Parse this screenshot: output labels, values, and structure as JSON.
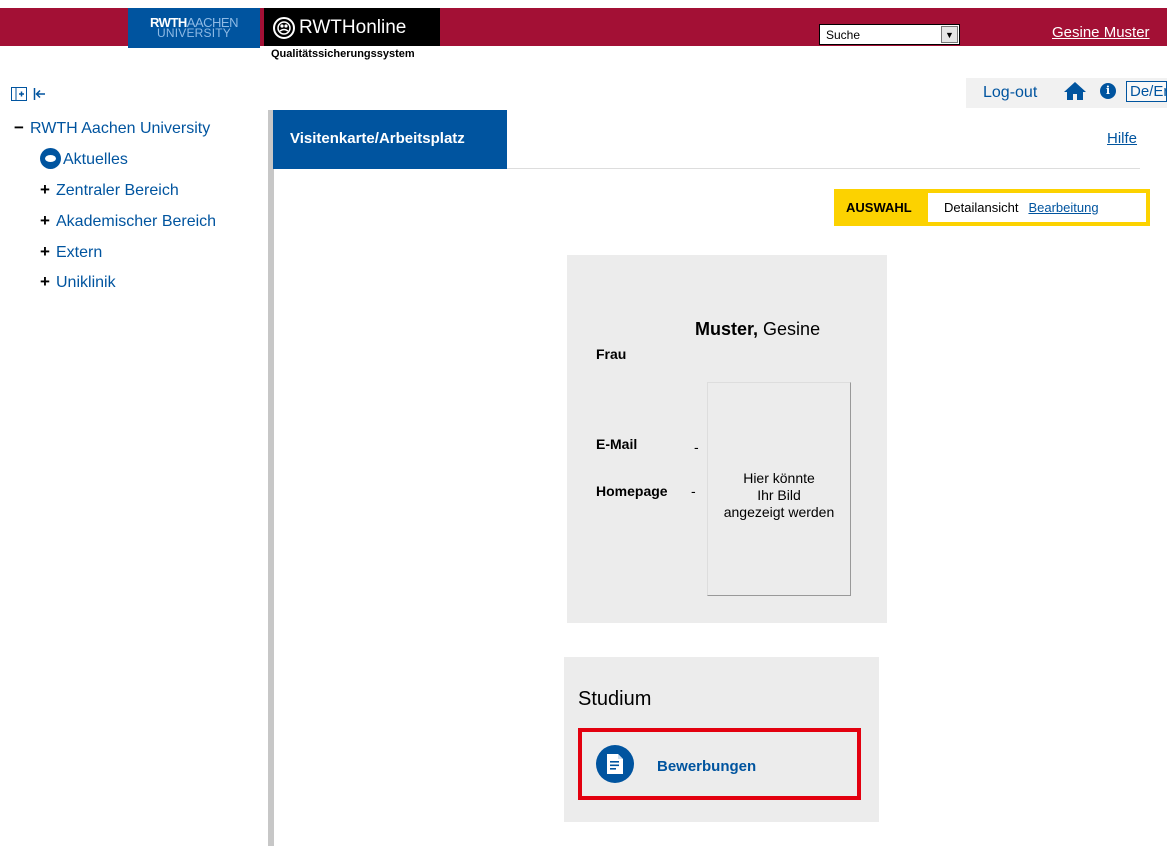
{
  "header": {
    "logo_rwth_bold": "RWTH",
    "logo_aachen": "AACHEN",
    "logo_university": "UNIVERSITY",
    "app_name": "RWTHonline",
    "subtitle": "Qualitätssicherungssystem",
    "search_value": "Suche",
    "user_name": "Gesine Muster",
    "brand_red": "#a31035",
    "brand_blue": "#00549f"
  },
  "utility": {
    "logout": "Log-out",
    "language": "De/En",
    "info_glyph": "i"
  },
  "sidebar": {
    "root": "RWTH Aachen University",
    "items": [
      {
        "label": "Aktuelles",
        "icon": "news-icon"
      },
      {
        "label": "Zentraler Bereich",
        "sym": "+"
      },
      {
        "label": "Akademischer Bereich",
        "sym": "+"
      },
      {
        "label": "Extern",
        "sym": "+"
      },
      {
        "label": "Uniklinik",
        "sym": "+"
      }
    ],
    "root_sym": "−"
  },
  "main": {
    "tab": "Visitenkarte/Arbeitsplatz",
    "help": "Hilfe",
    "auswahl": {
      "label": "AUSWAHL",
      "detail": "Detailansicht",
      "edit": "Bearbeitung"
    }
  },
  "card": {
    "salutation": "Frau",
    "last_name": "Muster,",
    "first_name": "Gesine",
    "email_label": "E-Mail",
    "email_value": "-",
    "homepage_label": "Homepage",
    "homepage_value": "-",
    "photo_line1": "Hier könnte",
    "photo_line2": "Ihr Bild",
    "photo_line3": "angezeigt werden"
  },
  "studium": {
    "title": "Studium",
    "applications": "Bewerbungen"
  }
}
